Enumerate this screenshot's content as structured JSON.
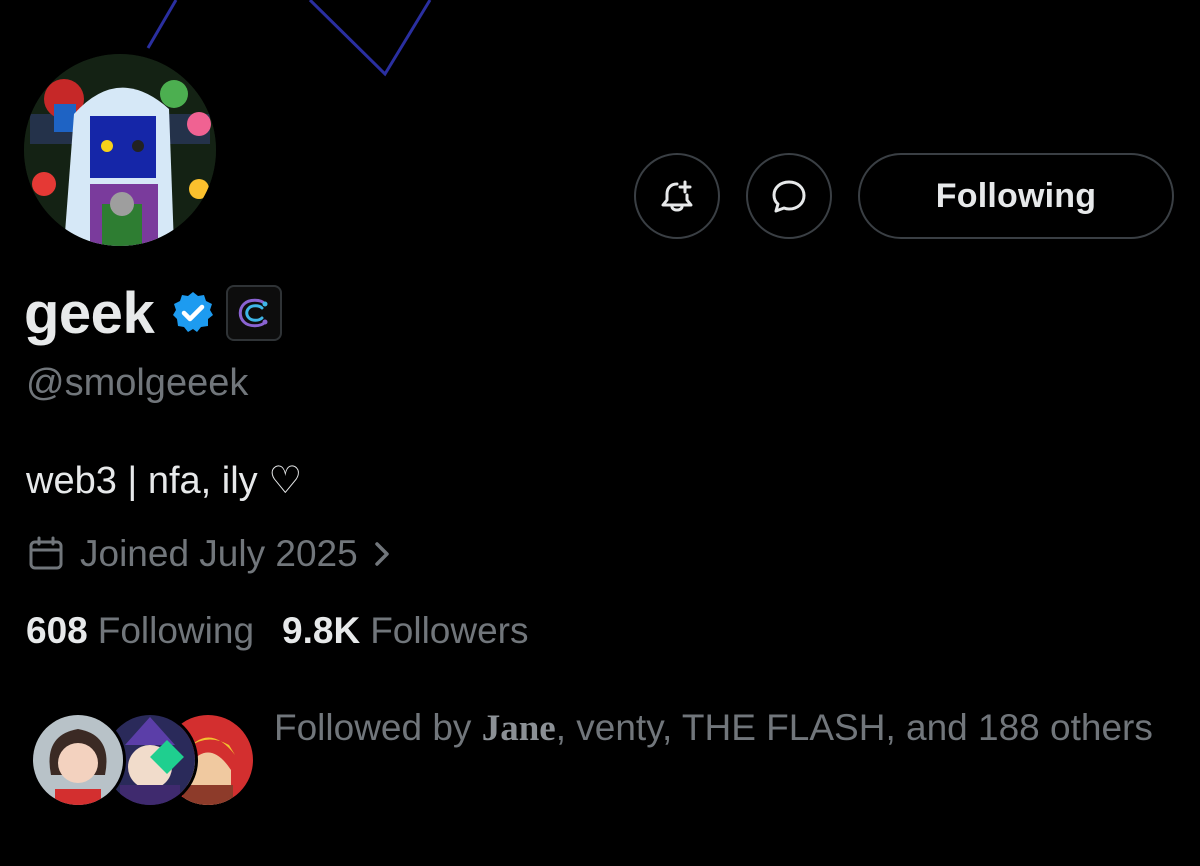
{
  "profile": {
    "display_name": "geek",
    "handle": "@smolgeeek",
    "bio": "web3 | nfa, ily ♡",
    "joined": "Joined July 2025",
    "verified": true
  },
  "actions": {
    "notify_icon": "bell-plus-icon",
    "message_icon": "chat-bubble-icon",
    "follow_label": "Following"
  },
  "stats": {
    "following_count": "608",
    "following_label": "Following",
    "followers_count": "9.8K",
    "followers_label": "Followers"
  },
  "followed_by": {
    "prefix": "Followed by ",
    "names": [
      "Jane",
      "venty",
      "THE FLASH"
    ],
    "sep1": ", ",
    "sep2": ", ",
    "sep3": ", and 188 others"
  },
  "colors": {
    "background": "#000000",
    "primary_text": "#e7e9ea",
    "secondary_text": "#71767b",
    "verified_blue": "#1d9bf0",
    "border": "#3a3f44"
  }
}
